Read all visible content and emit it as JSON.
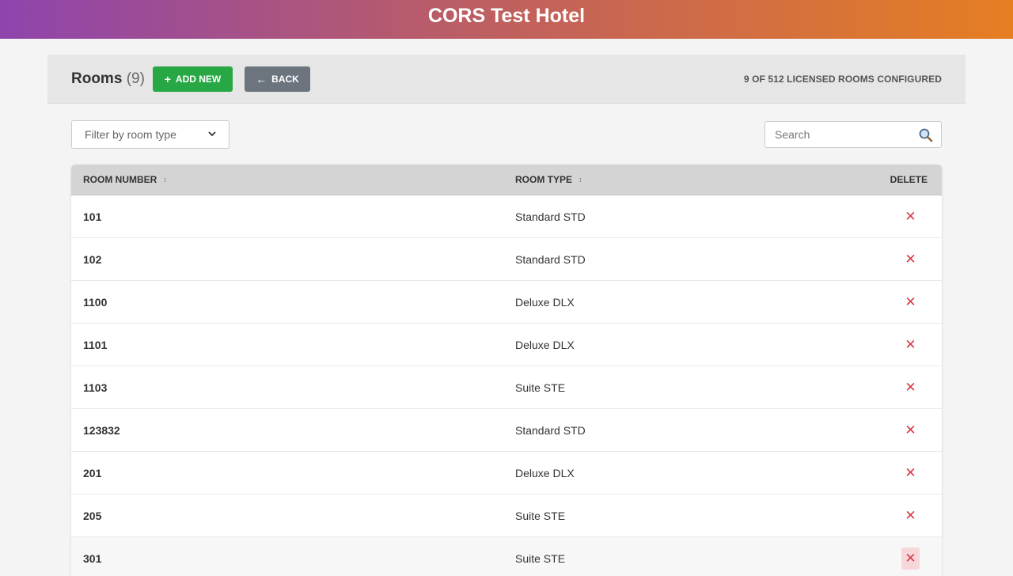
{
  "header": {
    "title": "CORS Test Hotel"
  },
  "toolbar": {
    "heading": "Rooms",
    "count": "(9)",
    "add_new_label": "ADD NEW",
    "back_label": "BACK",
    "licensed_text": "9 OF 512 LICENSED ROOMS CONFIGURED"
  },
  "filters": {
    "room_type_selected": "Filter by room type",
    "search_placeholder": "Search"
  },
  "table": {
    "columns": {
      "room_number": "ROOM NUMBER",
      "room_type": "ROOM TYPE",
      "delete": "DELETE"
    },
    "rows": [
      {
        "number": "101",
        "type": "Standard STD"
      },
      {
        "number": "102",
        "type": "Standard STD"
      },
      {
        "number": "1100",
        "type": "Deluxe DLX"
      },
      {
        "number": "1101",
        "type": "Deluxe DLX"
      },
      {
        "number": "1103",
        "type": "Suite STE"
      },
      {
        "number": "123832",
        "type": "Standard STD"
      },
      {
        "number": "201",
        "type": "Deluxe DLX"
      },
      {
        "number": "205",
        "type": "Suite STE"
      },
      {
        "number": "301",
        "type": "Suite STE"
      }
    ],
    "delete_glyph": "✕"
  },
  "colors": {
    "banner_start": "#8e44ad",
    "banner_end": "#e67e22",
    "add_button": "#28a745",
    "back_button": "#6c757d",
    "delete_icon": "#dc3545"
  },
  "icons": {
    "add": "plus-icon",
    "back": "arrow-left-icon",
    "search": "magnifier-icon",
    "sort": "sort-icon",
    "delete": "close-icon"
  }
}
